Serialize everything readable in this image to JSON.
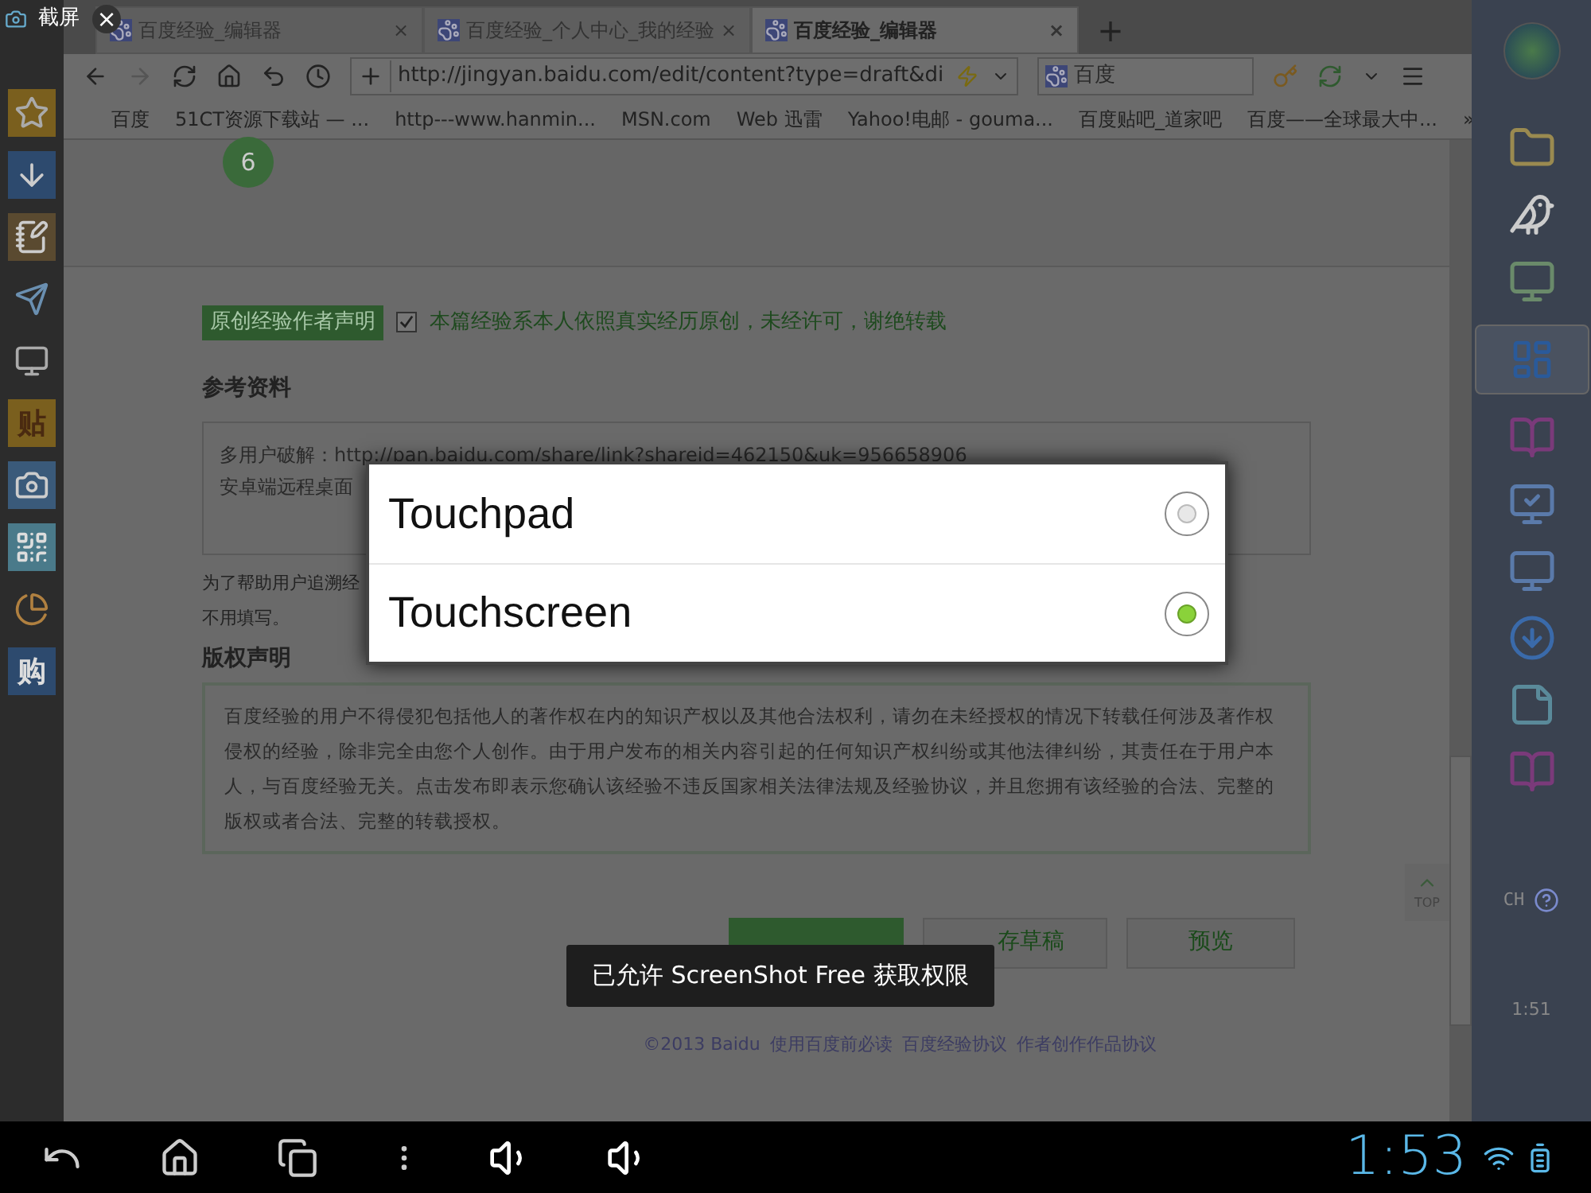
{
  "capture_label": {
    "title": "截屏",
    "close": "×"
  },
  "browser": {
    "tabs": [
      {
        "title": "百度经验_编辑器",
        "selected": false
      },
      {
        "title": "百度经验_个人中心_我的经验",
        "selected": false
      },
      {
        "title": "百度经验_编辑器",
        "selected": true
      }
    ],
    "tab_close": "×",
    "new_tab": "+",
    "address": "http://jingyan.baidu.com/edit/content?type=draft&di",
    "search_placeholder": "百度",
    "bookmarks": [
      "百度",
      "51CT资源下载站 — ...",
      "http---www.hanmin...",
      "MSN.com",
      "Web 迅雷",
      "Yahoo!电邮 - gouma...",
      "百度贴吧_道家吧",
      "百度——全球最大中..."
    ],
    "more_bookmarks": "»"
  },
  "page": {
    "step_number": "6",
    "original_tag": "原创经验作者声明",
    "original_checked": true,
    "original_text": "本篇经验系本人依照真实经历原创，未经许可，谢绝转载",
    "references_title": "参考资料",
    "references_lines": [
      "多用户破解：http://pan.baidu.com/share/link?shareid=462150&uk=956658906",
      "安卓端远程桌面"
    ],
    "help_lines": [
      "为了帮助用户追溯经",
      "不用填写。"
    ],
    "copyright_title": "版权声明",
    "copyright_text": "百度经验的用户不得侵犯包括他人的著作权在内的知识产权以及其他合法权利，请勿在未经授权的情况下转载任何涉及著作权侵权的经验，除非完全由您个人创作。由于用户发布的相关内容引起的任何知识产权纠纷或其他法律纠纷，其责任在于用户本人，与百度经验无关。点击发布即表示您确认该经验不违反国家相关法律法规及经验协议，并且您拥有该经验的合法、完整的版权或者合法、完整的转载授权。",
    "top_label": "TOP",
    "buttons": [
      "存草稿",
      "预览"
    ],
    "footer": [
      "©2013 Baidu",
      "使用百度前必读",
      "百度经验协议",
      "作者创作作品协议"
    ]
  },
  "left_dock": [
    "贴",
    "购"
  ],
  "dialog": {
    "options": [
      {
        "label": "Touchpad",
        "selected": false
      },
      {
        "label": "Touchscreen",
        "selected": true
      }
    ]
  },
  "toast": "已允许 ScreenShot Free 获取权限",
  "taskbar": {
    "language": "CH",
    "clock": "1:51"
  },
  "android_clock": "1:53"
}
